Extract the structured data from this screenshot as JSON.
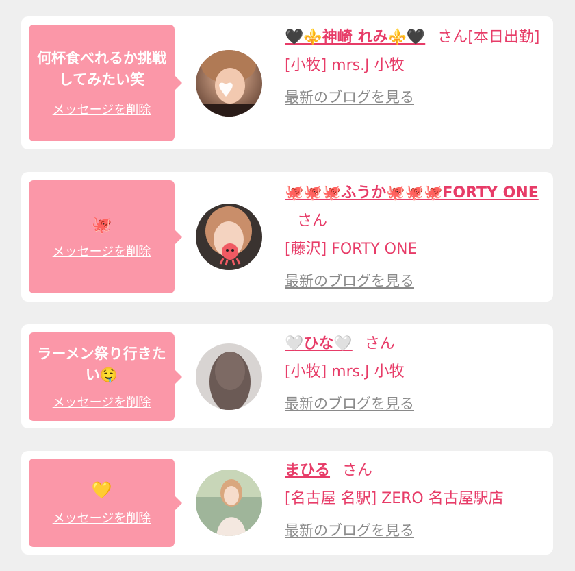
{
  "cards": [
    {
      "message": "何杯食べれるか挑戦してみたい笑",
      "delete_label": "メッセージを削除",
      "name": "🖤⚜️神崎 れみ⚜️🖤",
      "honorific": "さん",
      "status": "[本日出勤]",
      "shop": "[小牧] mrs.J 小牧",
      "blog_label": "最新のブログを見る"
    },
    {
      "message": "🐙",
      "delete_label": "メッセージを削除",
      "name": "🐙🐙🐙ふうか🐙🐙🐙FORTY ONE",
      "honorific": "さん",
      "shop": "[藤沢] FORTY ONE",
      "blog_label": "最新のブログを見る"
    },
    {
      "message": "ラーメン祭り行きたい🤤",
      "delete_label": "メッセージを削除",
      "name": "🤍ひな🤍",
      "honorific": "さん",
      "shop": "[小牧] mrs.J 小牧",
      "blog_label": "最新のブログを見る"
    },
    {
      "message": "💛",
      "delete_label": "メッセージを削除",
      "name": "まひる",
      "honorific": "さん",
      "shop": "[名古屋 名駅] ZERO 名古屋駅店",
      "blog_label": "最新のブログを見る"
    }
  ],
  "colors": {
    "bubble": "#fb97a8",
    "name": "#e73c68",
    "link_gray": "#8a8a8a",
    "background": "#efefef"
  }
}
